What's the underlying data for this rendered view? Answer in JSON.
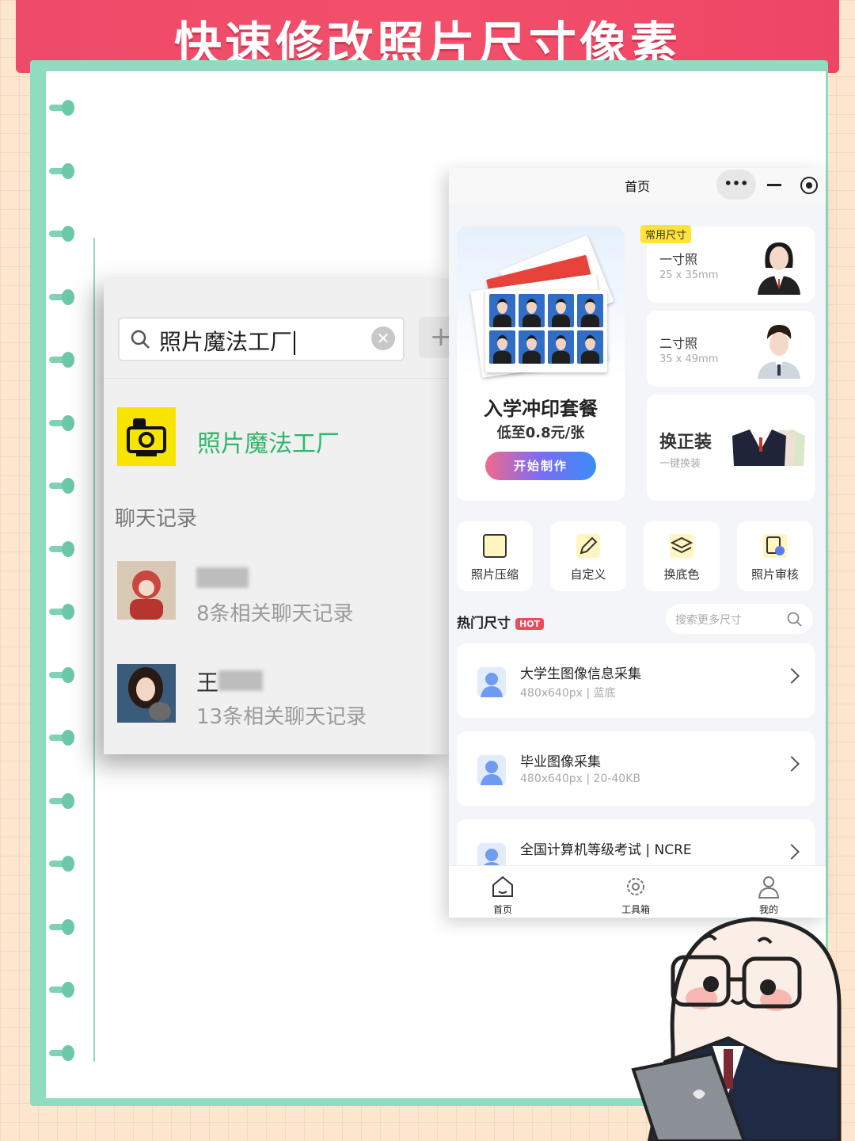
{
  "banner": {
    "title": "快速修改照片尺寸像素"
  },
  "wechat": {
    "search_value": "照片魔法工厂",
    "plus_label": "+",
    "result_app_name": "照片魔法工厂",
    "section_label": "聊天记录",
    "chats": [
      {
        "name": "",
        "count": "8条相关聊天记录"
      },
      {
        "name": "王",
        "count": "13条相关聊天记录"
      }
    ]
  },
  "miniprogram": {
    "title": "首页",
    "capsule_more": "•••",
    "promo": {
      "title": "入学冲印套餐",
      "subtitle": "低至0.8元/张",
      "button": "开始制作"
    },
    "size_badge": "常用尺寸",
    "sizes": [
      {
        "name": "一寸照",
        "dim": "25 x 35mm"
      },
      {
        "name": "二寸照",
        "dim": "35 x 49mm"
      }
    ],
    "suit": {
      "title": "换正装",
      "subtitle": "一键换装"
    },
    "tools": [
      {
        "label": "照片压缩",
        "icon": "compress-icon"
      },
      {
        "label": "自定义",
        "icon": "edit-icon"
      },
      {
        "label": "换底色",
        "icon": "layers-icon"
      },
      {
        "label": "照片审核",
        "icon": "audit-icon"
      }
    ],
    "hot": {
      "label": "热门尺寸",
      "badge": "HOT",
      "search_placeholder": "搜索更多尺寸"
    },
    "hot_items": [
      {
        "name": "大学生图像信息采集",
        "desc": "480x640px | 蓝底"
      },
      {
        "name": "毕业图像采集",
        "desc": "480x640px | 20-40KB"
      },
      {
        "name": "全国计算机等级考试 | NCRE",
        "desc": ""
      }
    ],
    "tabs": [
      {
        "label": "首页",
        "icon": "home-icon"
      },
      {
        "label": "工具箱",
        "icon": "gear-icon"
      },
      {
        "label": "我的",
        "icon": "user-icon"
      }
    ]
  },
  "colors": {
    "banner": "#ee4a6a",
    "accent_green": "#2eb86a",
    "notebook_green": "#8fdcc0",
    "hot_red": "#f04a5c"
  }
}
